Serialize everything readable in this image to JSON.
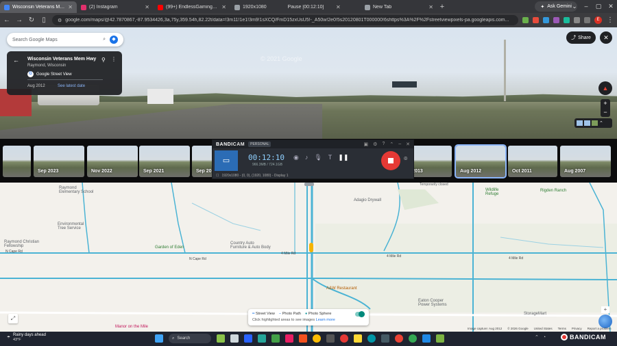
{
  "browser": {
    "tabs": [
      {
        "title": "Wisconsin Veterans Mem Hwy",
        "color": "#4285f4",
        "active": true
      },
      {
        "title": "(2) Instagram",
        "color": "#e1306c",
        "active": false
      },
      {
        "title": "(99+) EndlessGamingFanProductions",
        "color": "#ff0000",
        "active": false
      },
      {
        "title": "1920x1080",
        "color": "#9aa0a6",
        "active": false
      },
      {
        "title": "New Tab",
        "color": "#9aa0a6",
        "active": false
      }
    ],
    "recording_tab_status": "Pause [00:12:10]",
    "gemini_label": "Ask Gemini",
    "url": "google.com/maps/@42.7870867,-87.9534426,3a,75y,359.54h,82.22t/data=!3m11!1e1!3m9!1sXCQ/FmD15zxUsU5!-_A50w!2e0!5s20120801T000000!6shttps%3A%2F%2Fstreetviewpixels-pa.googleapis.com...",
    "profile_initial": "E"
  },
  "streetview": {
    "search_placeholder": "Search Google Maps",
    "location_title": "Wisconsin Veterans Mem Hwy",
    "location_sub": "Raymond, Wisconsin",
    "source": "Google Street View",
    "capture_date": "Aug 2012",
    "see_latest": "See latest date",
    "share_label": "Share",
    "watermark": "© 2021 Google"
  },
  "timeline": [
    {
      "label": "Sep 2023",
      "selected": false
    },
    {
      "label": "Nov 2022",
      "selected": false
    },
    {
      "label": "Sep 2021",
      "selected": false
    },
    {
      "label": "Sep 20",
      "selected": false
    },
    {
      "label": "p 2013",
      "selected": false
    },
    {
      "label": "Aug 2012",
      "selected": true
    },
    {
      "label": "Oct 2011",
      "selected": false
    },
    {
      "label": "Aug 2007",
      "selected": false
    }
  ],
  "bandicam": {
    "brand_bold": "BANDI",
    "brand_rest": "CAM",
    "tier": "PERSONAL",
    "timer": "00:12:10",
    "size": "966.3MB / 724.1GB",
    "display_info": "1920x1080 - (0, 0), (1920, 1080) - Display 1"
  },
  "map": {
    "labels": {
      "raymond_school": "Raymond\nElementary School",
      "env_tree": "Environmental\nTree Service",
      "raymond_christian": "Raymond Christian\nFellowship",
      "garden_eden": "Garden of Eden",
      "country_auto": "Country Auto\nFurniture & Auto Body",
      "adagio": "Adagio Drywall",
      "ridgen_ranch": "Rigden Ranch",
      "wildlife": "Wildlife\nRefuge",
      "temp_closed": "Temporarily closed",
      "aw": "A&W Restaurant",
      "eaton": "Eaton Cooper\nPower Systems",
      "storagemart": "StorageMart",
      "manor": "Manor on the Mile",
      "ncape_w": "N Cape Rd",
      "ncape_e": "N Cape Rd",
      "mile4_w": "4 Mile Rd",
      "mile4_m": "4 Mile Rd",
      "mile4_e": "4 Mile Rd"
    },
    "legend_items": [
      "Street View",
      "Photo Path",
      "Photo Sphere"
    ],
    "legend_hint": "Click highlighted areas to see images",
    "legend_link": "Learn more",
    "attribution": [
      "Image capture: Aug 2012",
      "© 2026 Google",
      "United States",
      "Terms",
      "Privacy",
      "Report a problem"
    ]
  },
  "taskbar": {
    "weather_line1": "Rainy days ahead",
    "weather_line2": "43°F",
    "search_label": "Search",
    "tray_brand": "BANDICAM"
  }
}
